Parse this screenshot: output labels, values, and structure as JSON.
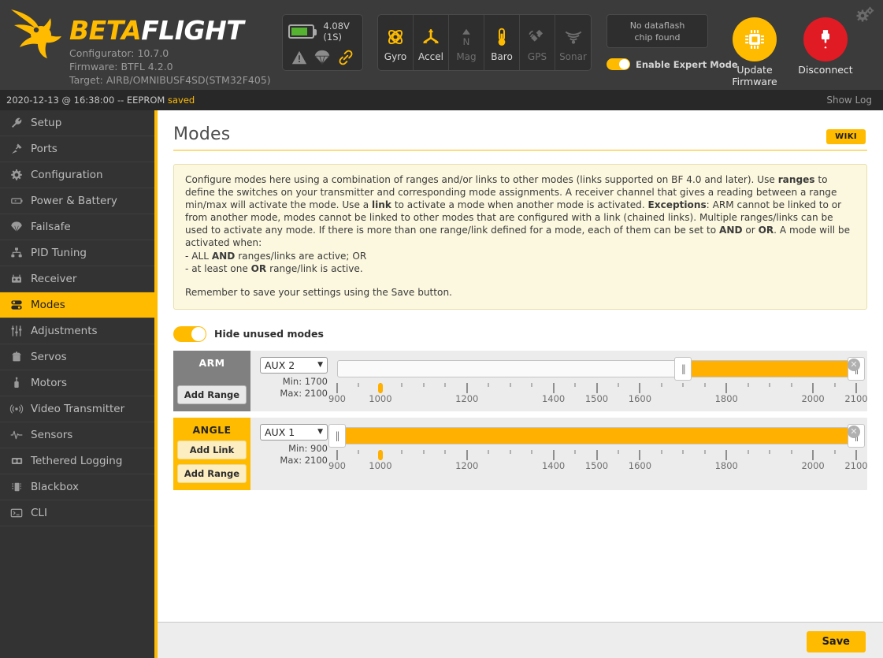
{
  "header": {
    "brand_beta": "BETA",
    "brand_flight": "FLIGHT",
    "configurator": "Configurator: 10.7.0",
    "firmware": "Firmware: BTFL 4.2.0",
    "target": "Target: AIRB/OMNIBUSF4SD(STM32F405)",
    "battery_voltage": "4.08V (1S)",
    "sensors": [
      {
        "name": "Gyro",
        "icon": "gyro-icon",
        "active": true
      },
      {
        "name": "Accel",
        "icon": "accel-icon",
        "active": true
      },
      {
        "name": "Mag",
        "icon": "mag-icon",
        "active": false
      },
      {
        "name": "Baro",
        "icon": "baro-icon",
        "active": true
      },
      {
        "name": "GPS",
        "icon": "gps-icon",
        "active": false
      },
      {
        "name": "Sonar",
        "icon": "sonar-icon",
        "active": false
      }
    ],
    "dataflash_line1": "No dataflash",
    "dataflash_line2": "chip found",
    "expert_mode_label": "Enable Expert Mode",
    "expert_mode_enabled": true,
    "update_firmware_line1": "Update",
    "update_firmware_line2": "Firmware",
    "disconnect_label": "Disconnect",
    "accent_color": "#ffbb00",
    "disconnect_color": "#e01b24"
  },
  "logbar": {
    "timestamp": "2020-12-13 @ 16:38:00 -- EEPROM ",
    "status": "saved",
    "show_log": "Show Log"
  },
  "sidebar": {
    "items": [
      {
        "label": "Setup",
        "icon": "wrench-icon",
        "active": false
      },
      {
        "label": "Ports",
        "icon": "plug-icon",
        "active": false
      },
      {
        "label": "Configuration",
        "icon": "gear-icon",
        "active": false
      },
      {
        "label": "Power & Battery",
        "icon": "battery-icon",
        "active": false
      },
      {
        "label": "Failsafe",
        "icon": "parachute-icon",
        "active": false
      },
      {
        "label": "PID Tuning",
        "icon": "sliders-icon",
        "active": false
      },
      {
        "label": "Receiver",
        "icon": "receiver-icon",
        "active": false
      },
      {
        "label": "Modes",
        "icon": "modes-icon",
        "active": true
      },
      {
        "label": "Adjustments",
        "icon": "faders-icon",
        "active": false
      },
      {
        "label": "Servos",
        "icon": "servo-icon",
        "active": false
      },
      {
        "label": "Motors",
        "icon": "motor-icon",
        "active": false
      },
      {
        "label": "Video Transmitter",
        "icon": "antenna-icon",
        "active": false
      },
      {
        "label": "Sensors",
        "icon": "waveform-icon",
        "active": false
      },
      {
        "label": "Tethered Logging",
        "icon": "logging-icon",
        "active": false
      },
      {
        "label": "Blackbox",
        "icon": "blackbox-icon",
        "active": false
      },
      {
        "label": "CLI",
        "icon": "terminal-icon",
        "active": false
      }
    ]
  },
  "main": {
    "title": "Modes",
    "wiki_button": "WIKI",
    "note": {
      "p1_a": "Configure modes here using a combination of ranges and/or links to other modes (links supported on BF 4.0 and later). Use ",
      "p1_b": "ranges",
      "p1_c": " to define the switches on your transmitter and corresponding mode assignments. A receiver channel that gives a reading between a range min/max will activate the mode. Use a ",
      "p1_d": "link",
      "p1_e": " to activate a mode when another mode is activated. ",
      "p1_f": "Exceptions",
      "p1_g": ": ARM cannot be linked to or from another mode, modes cannot be linked to other modes that are configured with a link (chained links). Multiple ranges/links can be used to activate any mode. If there is more than one range/link defined for a mode, each of them can be set to ",
      "p1_h": "AND",
      "p1_i": " or ",
      "p1_j": "OR",
      "p1_k": ". A mode will be activated when:",
      "bullet1_a": "- ALL ",
      "bullet1_b": "AND",
      "bullet1_c": " ranges/links are active; OR",
      "bullet2_a": "- at least one ",
      "bullet2_b": "OR",
      "bullet2_c": " range/link is active.",
      "p2": "Remember to save your settings using the Save button."
    },
    "hide_unused_label": "Hide unused modes",
    "hide_unused_enabled": true,
    "scale": {
      "min": 900,
      "max": 2100,
      "major_ticks": [
        900,
        1000,
        1200,
        1400,
        1500,
        1600,
        1800,
        2000,
        2100
      ],
      "minor_step": 50
    },
    "modes": [
      {
        "name": "ARM",
        "active": false,
        "buttons": [
          "Add Range"
        ],
        "channel": "AUX 2",
        "min_label": "Min: 1700",
        "max_label": "Max: 2100",
        "min": 1700,
        "max": 2100,
        "channel_value": 1000,
        "close_icon": "close-icon"
      },
      {
        "name": "ANGLE",
        "active": true,
        "buttons": [
          "Add Link",
          "Add Range"
        ],
        "channel": "AUX 1",
        "min_label": "Min: 900",
        "max_label": "Max: 2100",
        "min": 900,
        "max": 2100,
        "channel_value": 1000,
        "close_icon": "close-icon"
      }
    ]
  },
  "footer": {
    "save_label": "Save"
  }
}
